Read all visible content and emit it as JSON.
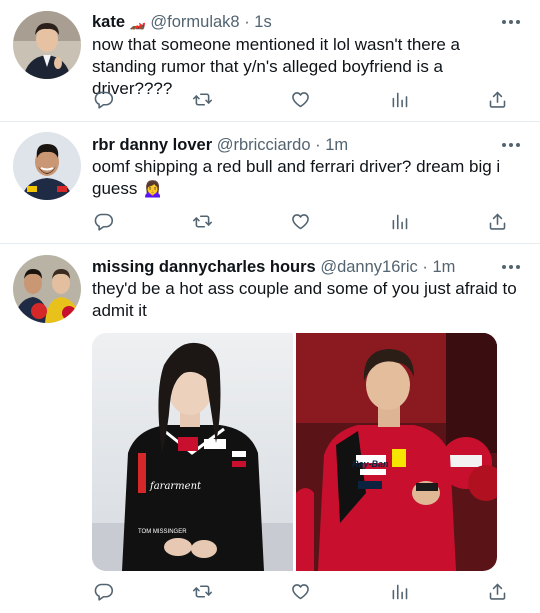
{
  "tweets": [
    {
      "name": "kate",
      "name_flag": "🏎️",
      "handle": "@formulak8",
      "time": "1s",
      "text": "now that someone mentioned it lol wasn't there a standing rumor that y/n's alleged boyfriend is a driver????"
    },
    {
      "name": "rbr danny lover",
      "handle": "@rbricciardo",
      "time": "1m",
      "text": "oomf shipping a red bull and ferrari driver? dream big i guess 🙍‍♀️"
    },
    {
      "name": "missing dannycharles hours",
      "handle": "@danny16ric",
      "time": "1m",
      "text": "they'd be a hot ass couple and some of you just afraid to admit it",
      "media_left_watermark": "fararment",
      "media_right_sponsor": "Ray-Ban"
    }
  ],
  "separator": "·",
  "colors": {
    "text": "#0f1419",
    "secondary": "#536471",
    "border": "#e6ecf0",
    "ferrari_red": "#c8102e"
  },
  "icons": [
    "reply-icon",
    "retweet-icon",
    "like-icon",
    "views-icon",
    "share-icon",
    "more-icon"
  ]
}
